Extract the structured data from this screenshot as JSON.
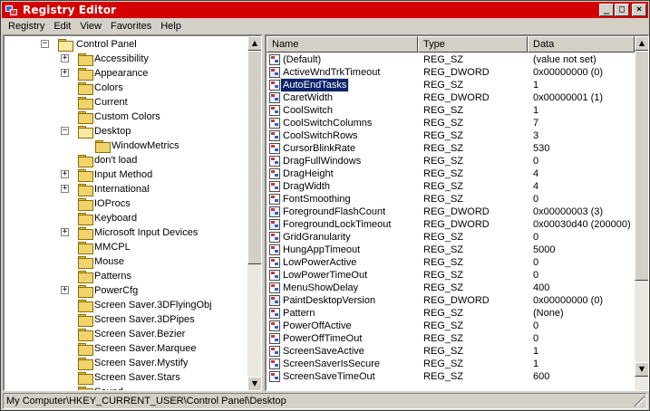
{
  "window": {
    "title": "Registry Editor",
    "controls": {
      "minimize": "_",
      "maximize": "□",
      "close": "×"
    }
  },
  "menu": [
    "Registry",
    "Edit",
    "View",
    "Favorites",
    "Help"
  ],
  "tree": {
    "root": {
      "label": "Control Panel",
      "expander": "−"
    },
    "items": [
      {
        "label": "Accessibility",
        "expander": "+"
      },
      {
        "label": "Appearance",
        "expander": "+"
      },
      {
        "label": "Colors",
        "expander": ""
      },
      {
        "label": "Current",
        "expander": ""
      },
      {
        "label": "Custom Colors",
        "expander": ""
      },
      {
        "label": "Desktop",
        "expander": "−",
        "open": true
      },
      {
        "label": "WindowMetrics",
        "expander": "",
        "child": true
      },
      {
        "label": "don't load",
        "expander": ""
      },
      {
        "label": "Input Method",
        "expander": "+"
      },
      {
        "label": "International",
        "expander": "+"
      },
      {
        "label": "IOProcs",
        "expander": ""
      },
      {
        "label": "Keyboard",
        "expander": ""
      },
      {
        "label": "Microsoft Input Devices",
        "expander": "+"
      },
      {
        "label": "MMCPL",
        "expander": ""
      },
      {
        "label": "Mouse",
        "expander": ""
      },
      {
        "label": "Patterns",
        "expander": ""
      },
      {
        "label": "PowerCfg",
        "expander": "+"
      },
      {
        "label": "Screen Saver.3DFlyingObj",
        "expander": ""
      },
      {
        "label": "Screen Saver.3DPipes",
        "expander": ""
      },
      {
        "label": "Screen Saver.Bezier",
        "expander": ""
      },
      {
        "label": "Screen Saver.Marquee",
        "expander": ""
      },
      {
        "label": "Screen Saver.Mystify",
        "expander": ""
      },
      {
        "label": "Screen Saver.Stars",
        "expander": ""
      },
      {
        "label": "Sound",
        "expander": ""
      }
    ]
  },
  "list": {
    "columns": [
      "Name",
      "Type",
      "Data"
    ],
    "selected_index": 2,
    "rows": [
      {
        "name": "(Default)",
        "type": "REG_SZ",
        "data": "(value not set)",
        "icon": "string-value-icon"
      },
      {
        "name": "ActiveWndTrkTimeout",
        "type": "REG_DWORD",
        "data": "0x00000000 (0)",
        "icon": "dword-value-icon"
      },
      {
        "name": "AutoEndTasks",
        "type": "REG_SZ",
        "data": "1",
        "icon": "string-value-icon"
      },
      {
        "name": "CaretWidth",
        "type": "REG_DWORD",
        "data": "0x00000001 (1)",
        "icon": "dword-value-icon"
      },
      {
        "name": "CoolSwitch",
        "type": "REG_SZ",
        "data": "1",
        "icon": "string-value-icon"
      },
      {
        "name": "CoolSwitchColumns",
        "type": "REG_SZ",
        "data": "7",
        "icon": "string-value-icon"
      },
      {
        "name": "CoolSwitchRows",
        "type": "REG_SZ",
        "data": "3",
        "icon": "string-value-icon"
      },
      {
        "name": "CursorBlinkRate",
        "type": "REG_SZ",
        "data": "530",
        "icon": "string-value-icon"
      },
      {
        "name": "DragFullWindows",
        "type": "REG_SZ",
        "data": "0",
        "icon": "string-value-icon"
      },
      {
        "name": "DragHeight",
        "type": "REG_SZ",
        "data": "4",
        "icon": "string-value-icon"
      },
      {
        "name": "DragWidth",
        "type": "REG_SZ",
        "data": "4",
        "icon": "string-value-icon"
      },
      {
        "name": "FontSmoothing",
        "type": "REG_SZ",
        "data": "0",
        "icon": "string-value-icon"
      },
      {
        "name": "ForegroundFlashCount",
        "type": "REG_DWORD",
        "data": "0x00000003 (3)",
        "icon": "dword-value-icon"
      },
      {
        "name": "ForegroundLockTimeout",
        "type": "REG_DWORD",
        "data": "0x00030d40 (200000)",
        "icon": "dword-value-icon"
      },
      {
        "name": "GridGranularity",
        "type": "REG_SZ",
        "data": "0",
        "icon": "string-value-icon"
      },
      {
        "name": "HungAppTimeout",
        "type": "REG_SZ",
        "data": "5000",
        "icon": "string-value-icon"
      },
      {
        "name": "LowPowerActive",
        "type": "REG_SZ",
        "data": "0",
        "icon": "string-value-icon"
      },
      {
        "name": "LowPowerTimeOut",
        "type": "REG_SZ",
        "data": "0",
        "icon": "string-value-icon"
      },
      {
        "name": "MenuShowDelay",
        "type": "REG_SZ",
        "data": "400",
        "icon": "string-value-icon"
      },
      {
        "name": "PaintDesktopVersion",
        "type": "REG_DWORD",
        "data": "0x00000000 (0)",
        "icon": "dword-value-icon"
      },
      {
        "name": "Pattern",
        "type": "REG_SZ",
        "data": "(None)",
        "icon": "string-value-icon"
      },
      {
        "name": "PowerOffActive",
        "type": "REG_SZ",
        "data": "0",
        "icon": "string-value-icon"
      },
      {
        "name": "PowerOffTimeOut",
        "type": "REG_SZ",
        "data": "0",
        "icon": "string-value-icon"
      },
      {
        "name": "ScreenSaveActive",
        "type": "REG_SZ",
        "data": "1",
        "icon": "string-value-icon"
      },
      {
        "name": "ScreenSaverIsSecure",
        "type": "REG_SZ",
        "data": "1",
        "icon": "string-value-icon"
      },
      {
        "name": "ScreenSaveTimeOut",
        "type": "REG_SZ",
        "data": "600",
        "icon": "string-value-icon"
      }
    ]
  },
  "statusbar": {
    "path": "My Computer\\HKEY_CURRENT_USER\\Control Panel\\Desktop"
  },
  "scrollbars": {
    "up_arrow": "▲",
    "down_arrow": "▼"
  },
  "colors": {
    "titlebar": "#d20000",
    "selection": "#0a246a",
    "chrome": "#d4d0c8"
  }
}
